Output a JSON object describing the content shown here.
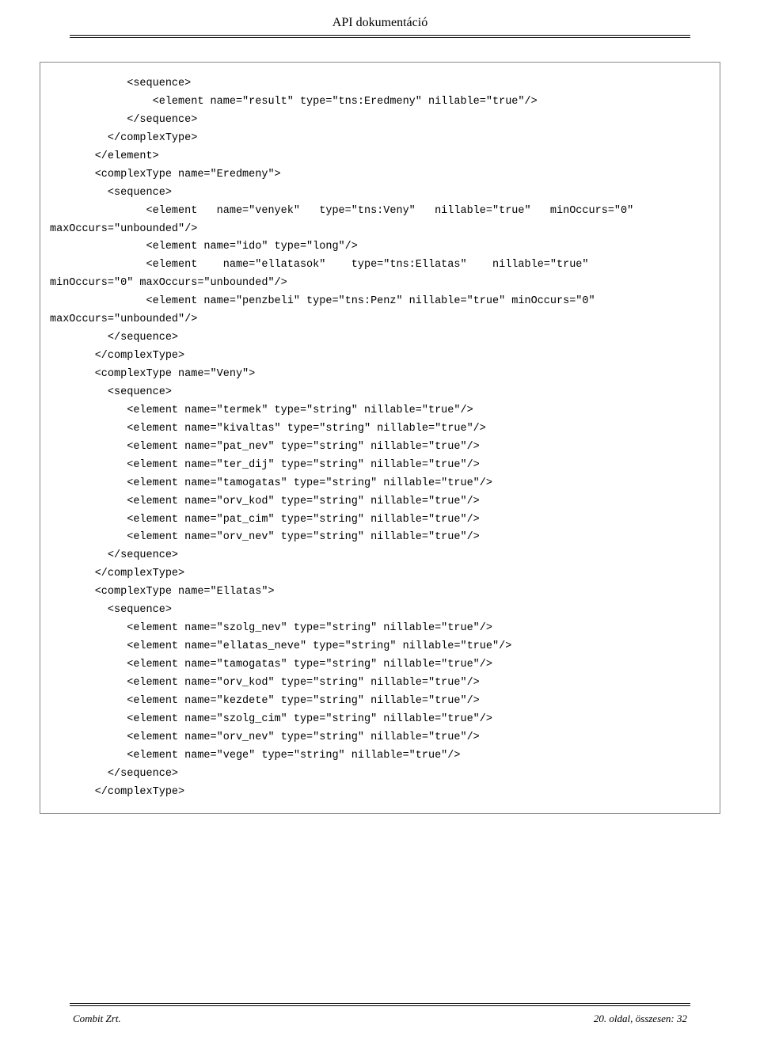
{
  "header": {
    "title": "API dokumentáció"
  },
  "code": {
    "lines": [
      "            <sequence>",
      "                <element name=\"result\" type=\"tns:Eredmeny\" nillable=\"true\"/>",
      "            </sequence>",
      "         </complexType>",
      "       </element>",
      "       <complexType name=\"Eredmeny\">",
      "         <sequence>",
      "               <element   name=\"venyek\"   type=\"tns:Veny\"   nillable=\"true\"   minOccurs=\"0\"",
      "maxOccurs=\"unbounded\"/>",
      "               <element name=\"ido\" type=\"long\"/>",
      "               <element    name=\"ellatasok\"    type=\"tns:Ellatas\"    nillable=\"true\"",
      "minOccurs=\"0\" maxOccurs=\"unbounded\"/>",
      "               <element name=\"penzbeli\" type=\"tns:Penz\" nillable=\"true\" minOccurs=\"0\"",
      "maxOccurs=\"unbounded\"/>",
      "         </sequence>",
      "       </complexType>",
      "       <complexType name=\"Veny\">",
      "         <sequence>",
      "            <element name=\"termek\" type=\"string\" nillable=\"true\"/>",
      "            <element name=\"kivaltas\" type=\"string\" nillable=\"true\"/>",
      "            <element name=\"pat_nev\" type=\"string\" nillable=\"true\"/>",
      "            <element name=\"ter_dij\" type=\"string\" nillable=\"true\"/>",
      "            <element name=\"tamogatas\" type=\"string\" nillable=\"true\"/>",
      "            <element name=\"orv_kod\" type=\"string\" nillable=\"true\"/>",
      "            <element name=\"pat_cim\" type=\"string\" nillable=\"true\"/>",
      "            <element name=\"orv_nev\" type=\"string\" nillable=\"true\"/>",
      "         </sequence>",
      "       </complexType>",
      "       <complexType name=\"Ellatas\">",
      "         <sequence>",
      "            <element name=\"szolg_nev\" type=\"string\" nillable=\"true\"/>",
      "            <element name=\"ellatas_neve\" type=\"string\" nillable=\"true\"/>",
      "            <element name=\"tamogatas\" type=\"string\" nillable=\"true\"/>",
      "            <element name=\"orv_kod\" type=\"string\" nillable=\"true\"/>",
      "            <element name=\"kezdete\" type=\"string\" nillable=\"true\"/>",
      "            <element name=\"szolg_cim\" type=\"string\" nillable=\"true\"/>",
      "            <element name=\"orv_nev\" type=\"string\" nillable=\"true\"/>",
      "            <element name=\"vege\" type=\"string\" nillable=\"true\"/>",
      "         </sequence>",
      "       </complexType>"
    ]
  },
  "footer": {
    "left": "Combit Zrt.",
    "right": "20. oldal, összesen: 32"
  }
}
